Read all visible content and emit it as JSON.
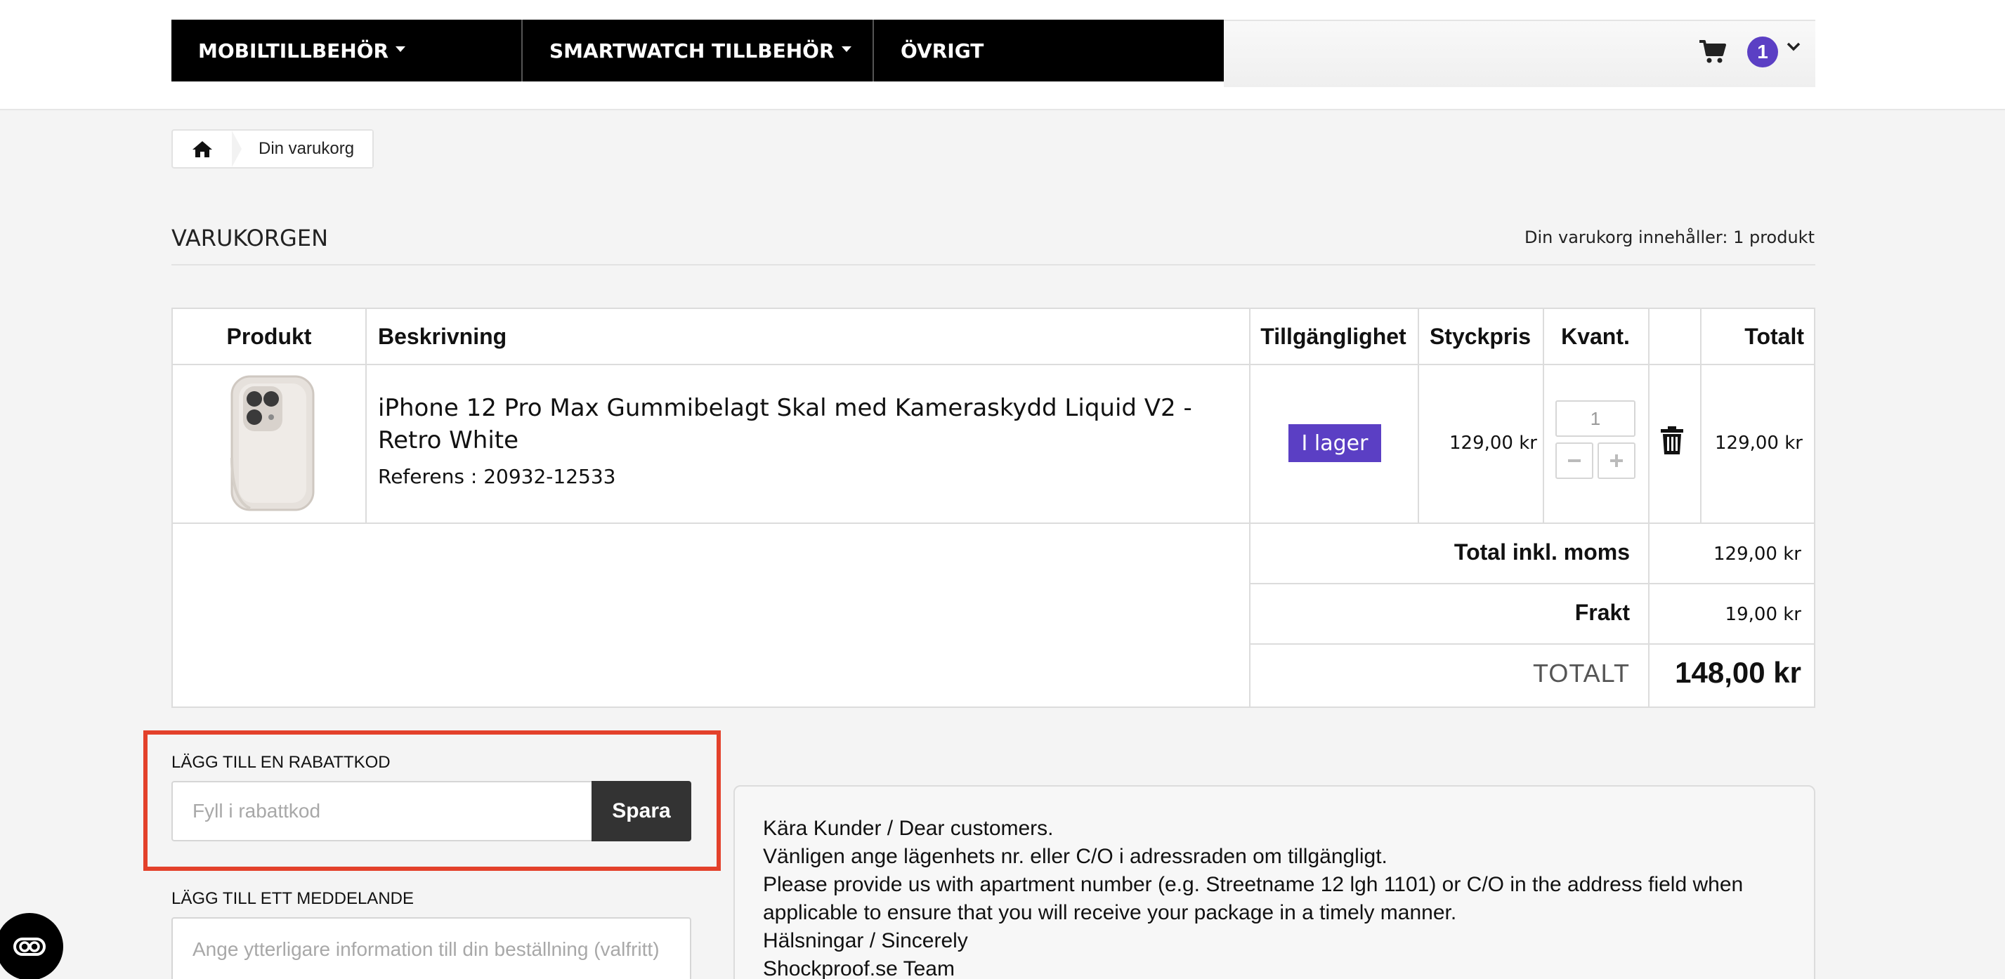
{
  "nav": {
    "items": [
      {
        "label": "MOBILTILLBEHÖR",
        "has_dropdown": true
      },
      {
        "label": "SMARTWATCH TILLBEHÖR",
        "has_dropdown": true
      },
      {
        "label": "ÖVRIGT",
        "has_dropdown": false
      }
    ],
    "cart_badge": "1",
    "cart_icon": "cart-icon",
    "accent_color": "#5b3fc4"
  },
  "breadcrumb": {
    "home_icon": "home-icon",
    "current": "Din varukorg"
  },
  "page": {
    "title": "VARUKORGEN",
    "cart_count": "Din varukorg innehåller: 1 produkt"
  },
  "table": {
    "headers": {
      "product": "Produkt",
      "description": "Beskrivning",
      "availability": "Tillgänglighet",
      "unit_price": "Styckpris",
      "quantity": "Kvant.",
      "total": "Totalt"
    },
    "rows": [
      {
        "name": "iPhone 12 Pro Max Gummibelagt Skal med Kameraskydd Liquid V2 - Retro White",
        "reference": "Referens : 20932-12533",
        "availability": "I lager",
        "unit_price": "129,00 kr",
        "quantity": "1",
        "line_total": "129,00 kr"
      }
    ],
    "summary": {
      "total_incl_vat_label": "Total inkl. moms",
      "total_incl_vat_value": "129,00 kr",
      "shipping_label": "Frakt",
      "shipping_value": "19,00 kr",
      "grand_total_label": "TOTALT",
      "grand_total_value": "148,00 kr"
    }
  },
  "discount": {
    "heading": "LÄGG TILL EN RABATTKOD",
    "placeholder": "Fyll i rabattkod",
    "button": "Spara",
    "highlight_color": "#e3412b"
  },
  "message": {
    "heading": "LÄGG TILL ETT MEDDELANDE",
    "placeholder": "Ange ytterligare information till din beställning (valfritt)"
  },
  "notice": {
    "lines": [
      "Kära Kunder / Dear customers.",
      "Vänligen ange lägenhets nr. eller C/O i adressraden om tillgängligt.",
      "Please provide us with apartment number (e.g. Streetname 12 lgh 1101) or C/O in the address field when applicable to ensure that you will receive your package in a timely manner.",
      "Hälsningar / Sincerely",
      "Shockproof.se Team"
    ]
  },
  "floating_button": {
    "icon": "accessibility-icon"
  }
}
